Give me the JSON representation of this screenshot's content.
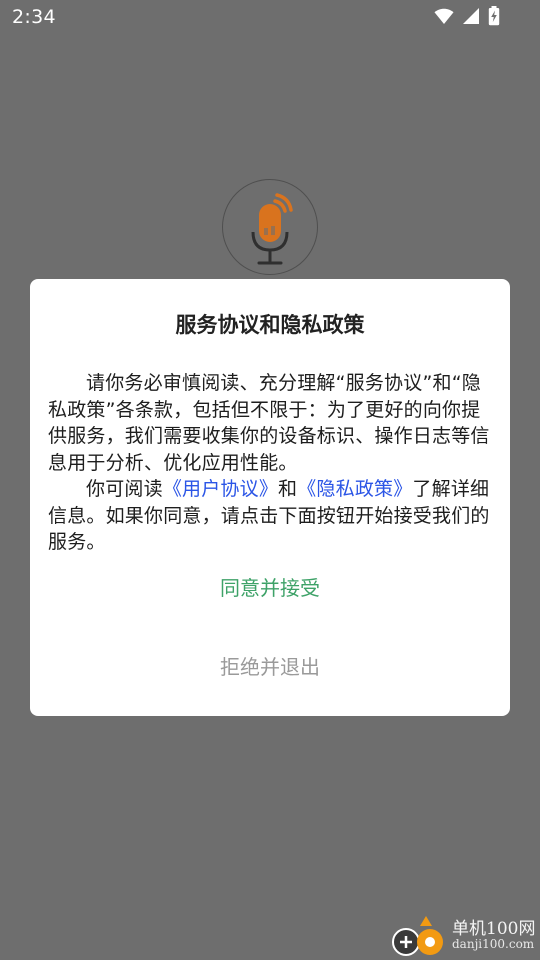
{
  "status_bar": {
    "time": "2:34",
    "icons": [
      "wifi-icon",
      "cellular-signal-icon",
      "battery-charging-icon"
    ]
  },
  "app_icon": "microphone-recorder-icon",
  "dialog": {
    "title": "服务协议和隐私政策",
    "paragraph1": "请你务必审慎阅读、充分理解“服务协议”和“隐私政策”各条款，包括但不限于：为了更好的向你提供服务，我们需要收集你的设备标识、操作日志等信息用于分析、优化应用性能。",
    "paragraph2_prefix": "你可阅读",
    "user_agreement_link": "《用户协议》",
    "paragraph2_middle": "和",
    "privacy_policy_link": "《隐私政策》",
    "paragraph2_suffix": "了解详细信息。如果你同意，请点击下面按钮开始接受我们的服务。",
    "accept_label": "同意并接受",
    "reject_label": "拒绝并退出"
  },
  "watermark": {
    "name": "单机100网",
    "url": "danji100.com"
  },
  "colors": {
    "overlay_background": "#6e6e6e",
    "accept": "#3ea268",
    "reject": "#9a9a9a",
    "link": "#2b55e6",
    "mic_orange": "#d9731e"
  }
}
